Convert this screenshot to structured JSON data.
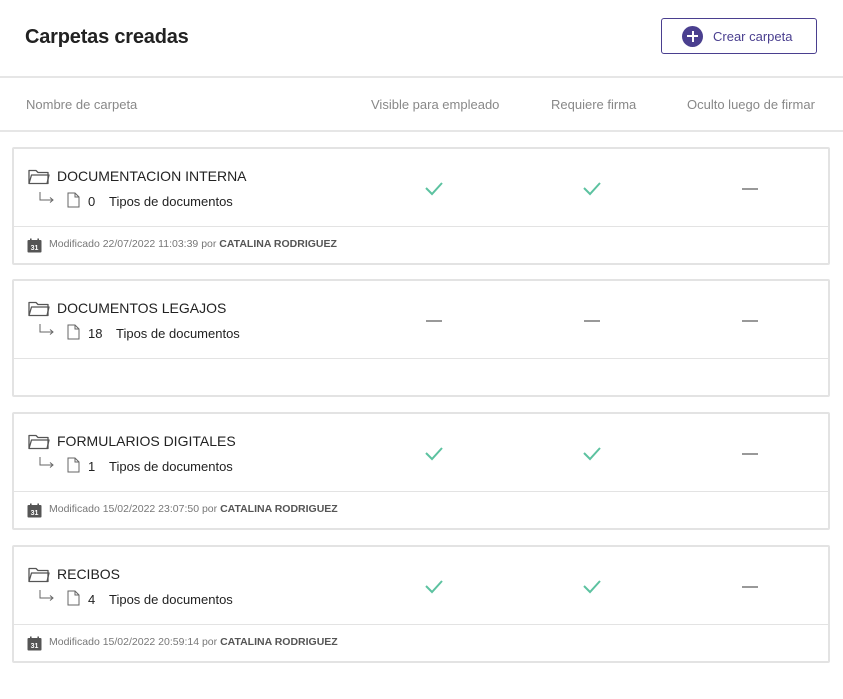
{
  "header": {
    "title": "Carpetas creadas",
    "create_button_label": "Crear carpeta"
  },
  "columns": {
    "name": "Nombre de carpeta",
    "visible": "Visible para empleado",
    "requires_signature": "Requiere firma",
    "hidden_after_sign": "Oculto luego de firmar"
  },
  "colors": {
    "accent": "#4a3f8f",
    "check": "#5cc2a0",
    "dash": "#999999"
  },
  "folders": [
    {
      "name": "DOCUMENTACION INTERNA",
      "doc_count": "0",
      "doc_label": "Tipos de documentos",
      "visible": true,
      "requires_signature": true,
      "hidden_after_sign": false,
      "modified_prefix": "Modificado",
      "modified_date": "22/07/2022 11:03:39",
      "modified_by_prefix": "por",
      "modified_by": "CATALINA RODRIGUEZ"
    },
    {
      "name": "DOCUMENTOS LEGAJOS",
      "doc_count": "18",
      "doc_label": "Tipos de documentos",
      "visible": false,
      "requires_signature": false,
      "hidden_after_sign": false
    },
    {
      "name": "FORMULARIOS DIGITALES",
      "doc_count": "1",
      "doc_label": "Tipos de documentos",
      "visible": true,
      "requires_signature": true,
      "hidden_after_sign": false,
      "modified_prefix": "Modificado",
      "modified_date": "15/02/2022 23:07:50",
      "modified_by_prefix": "por",
      "modified_by": "CATALINA RODRIGUEZ"
    },
    {
      "name": "RECIBOS",
      "doc_count": "4",
      "doc_label": "Tipos de documentos",
      "visible": true,
      "requires_signature": true,
      "hidden_after_sign": false,
      "modified_prefix": "Modificado",
      "modified_date": "15/02/2022 20:59:14",
      "modified_by_prefix": "por",
      "modified_by": "CATALINA RODRIGUEZ"
    }
  ]
}
